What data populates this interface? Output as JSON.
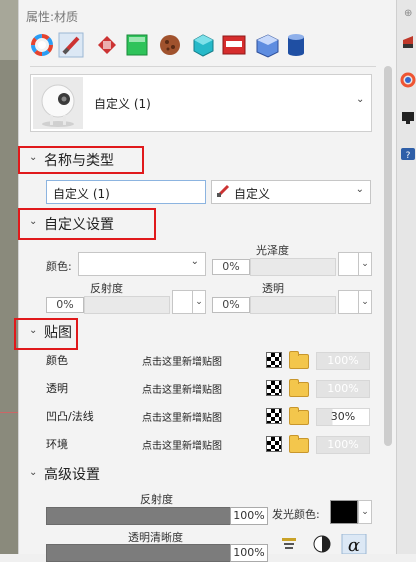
{
  "panel": {
    "title": "属性:材质",
    "pin": "⊕"
  },
  "toolbar": {
    "icons": [
      "color-wheel-icon",
      "brush-icon",
      "paint-bucket-icon",
      "green-square-icon",
      "sphere-icon",
      "teal-box-icon",
      "red-box-icon",
      "crystal-icon",
      "cylinder-icon"
    ]
  },
  "preview": {
    "name": "自定义 (1)"
  },
  "section_name_type": {
    "title": "名称与类型",
    "name_value": "自定义 (1)",
    "type_value": "自定义"
  },
  "section_custom": {
    "title": "自定义设置",
    "color_label": "颜色:",
    "gloss_label": "光泽度",
    "gloss_value": "0%",
    "reflect_label": "反射度",
    "reflect_value": "0%",
    "transp_label": "透明",
    "transp_value": "0%"
  },
  "section_map": {
    "title": "贴图",
    "rows": [
      {
        "label": "颜色",
        "link": "点击这里新增贴图",
        "value": "100%",
        "fill": 0
      },
      {
        "label": "透明",
        "link": "点击这里新增贴图",
        "value": "100%",
        "fill": 0
      },
      {
        "label": "凹凸/法线",
        "link": "点击这里新增贴图",
        "value": "30%",
        "fill": 0.3
      },
      {
        "label": "环境",
        "link": "点击这里新增贴图",
        "value": "100%",
        "fill": 0
      }
    ]
  },
  "section_adv": {
    "title": "高级设置",
    "reflect_label": "反射度",
    "reflect_value": "100%",
    "emit_label": "发光颜色:",
    "clarity_label": "透明清晰度",
    "clarity_value": "100%",
    "emit_color": "#000000"
  },
  "colors": {
    "red_highlight": "#e0191b",
    "accent_blue": "#8cb4e0"
  }
}
